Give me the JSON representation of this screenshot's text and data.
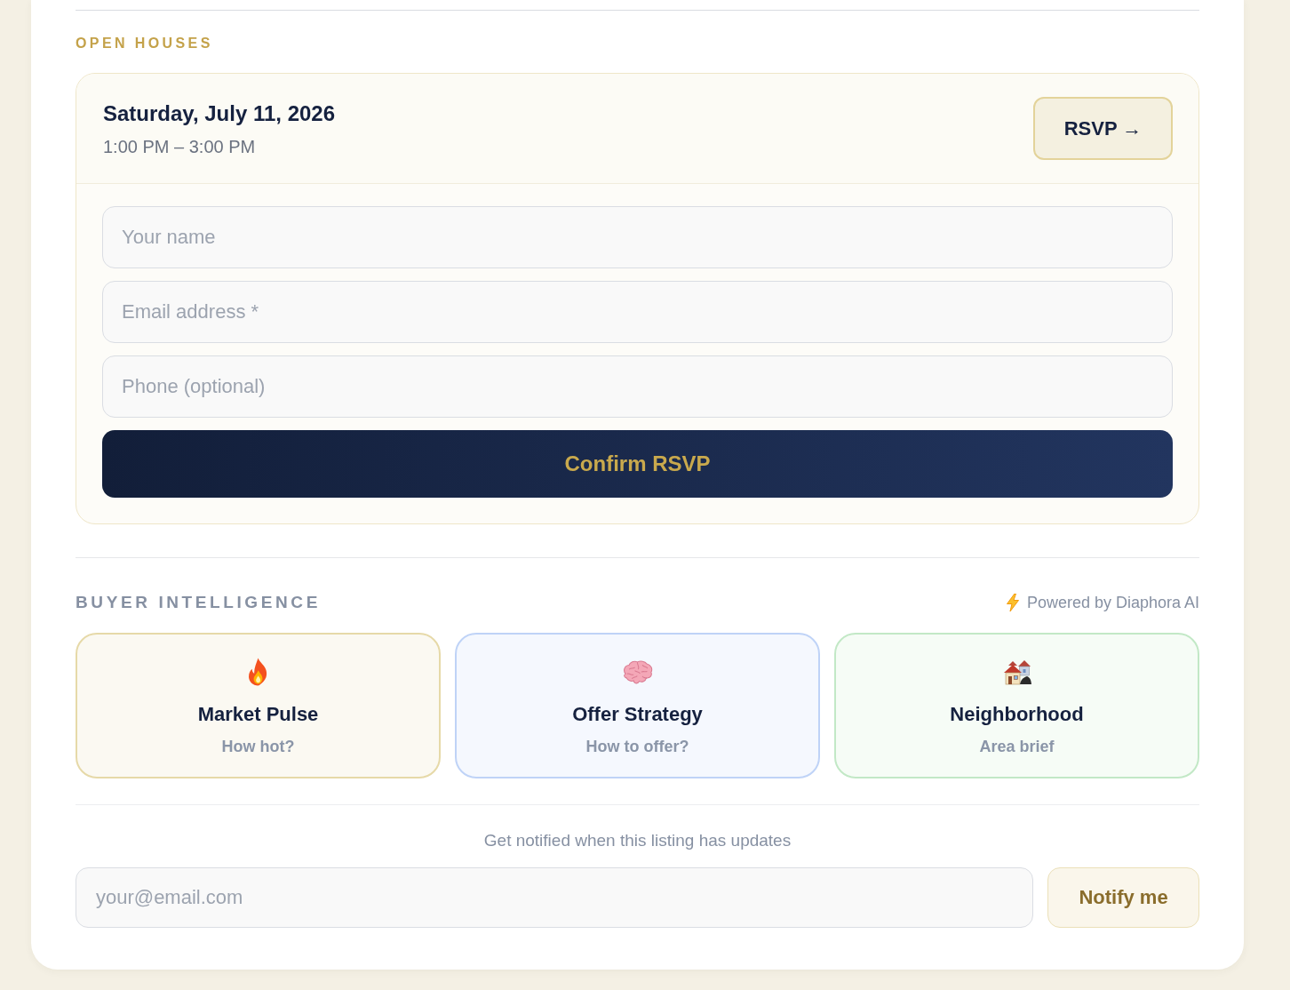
{
  "open_houses": {
    "heading": "OPEN HOUSES",
    "events": [
      {
        "date": "Saturday, July 11, 2026",
        "time": "1:00 PM – 3:00 PM",
        "rsvp_button": "RSVP →",
        "form": {
          "fields": [
            {
              "placeholder": "Your name"
            },
            {
              "placeholder": "Email address *"
            },
            {
              "placeholder": "Phone (optional)"
            }
          ],
          "submit_button": "Confirm RSVP"
        }
      }
    ]
  },
  "buyer_intelligence": {
    "heading": "BUYER INTELLIGENCE",
    "powered_by": "Powered by Diaphora AI",
    "cards": [
      {
        "kind": "market",
        "title": "Market Pulse",
        "subtitle": "How hot?",
        "color": "#e6d9a8"
      },
      {
        "kind": "offer",
        "title": "Offer Strategy",
        "subtitle": "How to offer?",
        "color": "#bfd3f7"
      },
      {
        "kind": "area",
        "title": "Neighborhood",
        "subtitle": "Area brief",
        "color": "#c2e8c6"
      }
    ]
  },
  "notify": {
    "prompt": "Get notified when this listing has updates",
    "email_field": {
      "placeholder": "your@email.com"
    },
    "button": "Notify me"
  }
}
